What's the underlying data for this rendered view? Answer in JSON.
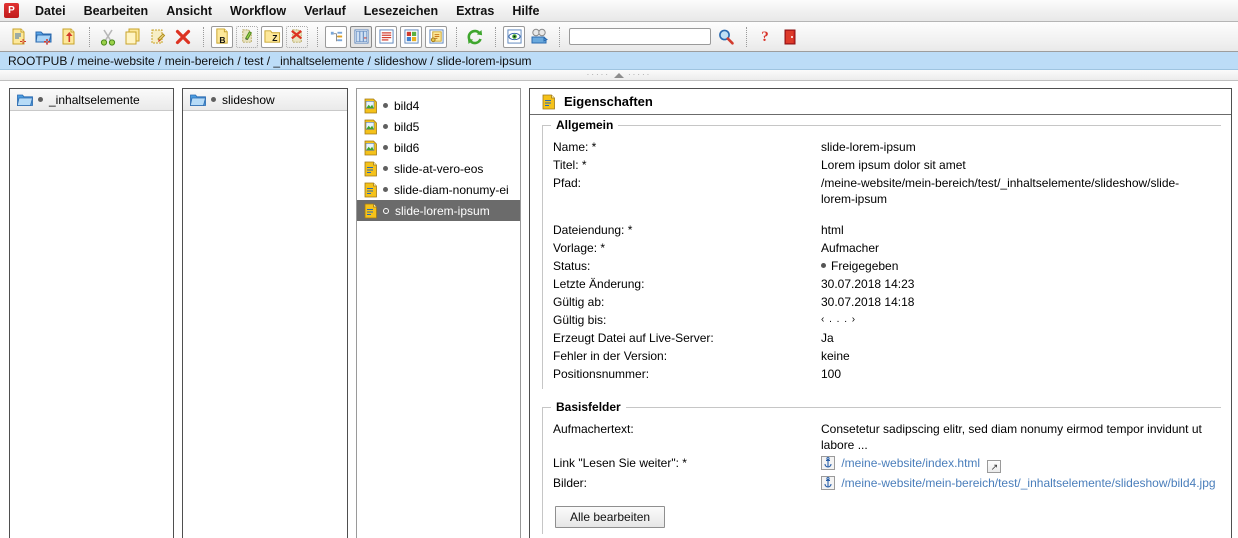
{
  "app": {
    "logo_text": "P",
    "menu": [
      "Datei",
      "Bearbeiten",
      "Ansicht",
      "Workflow",
      "Verlauf",
      "Lesezeichen",
      "Extras",
      "Hilfe"
    ]
  },
  "toolbar": {
    "search_value": "",
    "search_placeholder": "",
    "buttons": [
      {
        "name": "new-page-icon"
      },
      {
        "name": "new-folder-icon"
      },
      {
        "name": "upload-file-icon"
      },
      {
        "name": "cut-icon"
      },
      {
        "name": "copy-icon"
      },
      {
        "name": "paste-icon"
      },
      {
        "name": "delete-icon"
      },
      {
        "name": "edit-content-icon"
      },
      {
        "name": "edit-metadata-icon"
      },
      {
        "name": "edit-folder-icon"
      },
      {
        "name": "cancel-edit-icon"
      },
      {
        "name": "tree-view-icon"
      },
      {
        "name": "columns-view-icon"
      },
      {
        "name": "list-view-icon"
      },
      {
        "name": "thumbnail-view-icon"
      },
      {
        "name": "details-view-icon"
      },
      {
        "name": "refresh-icon"
      },
      {
        "name": "preview-icon"
      },
      {
        "name": "publish-icon"
      },
      {
        "name": "search-icon"
      },
      {
        "name": "help-icon"
      },
      {
        "name": "exit-icon"
      }
    ]
  },
  "breadcrumb": {
    "text": "ROOTPUB / meine-website / mein-bereich / test / _inhaltselemente / slideshow / slide-lorem-ipsum"
  },
  "columns": [
    {
      "header": {
        "label": "_inhaltselemente",
        "icon": "folder-icon"
      },
      "rows": []
    },
    {
      "header": {
        "label": "slideshow",
        "icon": "folder-icon"
      },
      "rows": []
    },
    {
      "header": null,
      "rows": [
        {
          "label": "bild4",
          "icon": "image-file-icon",
          "selected": false
        },
        {
          "label": "bild5",
          "icon": "image-file-icon",
          "selected": false
        },
        {
          "label": "bild6",
          "icon": "image-file-icon",
          "selected": false
        },
        {
          "label": "slide-at-vero-eos",
          "icon": "page-file-icon",
          "selected": false
        },
        {
          "label": "slide-diam-nonumy-ei",
          "icon": "page-file-icon",
          "selected": false
        },
        {
          "label": "slide-lorem-ipsum",
          "icon": "page-file-icon",
          "selected": true
        }
      ]
    }
  ],
  "panel": {
    "title": "Eigenschaften",
    "title_icon": "page-file-icon",
    "allgemein": {
      "legend": "Allgemein",
      "rows": [
        {
          "label": "Name: *",
          "value": "slide-lorem-ipsum",
          "style": "link"
        },
        {
          "label": "Titel: *",
          "value": "Lorem ipsum dolor sit amet",
          "style": "link"
        },
        {
          "label": "Pfad:",
          "value": "/meine-website/mein-bereich/test/_inhaltselemente/slideshow/slide-lorem-ipsum",
          "style": "plain"
        },
        {
          "label": "",
          "value": "",
          "style": "spacer"
        },
        {
          "label": "Dateiendung: *",
          "value": "html",
          "style": "link"
        },
        {
          "label": "Vorlage: *",
          "value": "Aufmacher",
          "style": "link"
        },
        {
          "label": "Status:",
          "value": "Freigegeben",
          "style": "status"
        },
        {
          "label": "Letzte Änderung:",
          "value": "30.07.2018 14:23",
          "style": "plain"
        },
        {
          "label": "Gültig ab:",
          "value": "30.07.2018 14:18",
          "style": "link"
        },
        {
          "label": "Gültig bis:",
          "value": "‹ . . . ›",
          "style": "empty"
        },
        {
          "label": "Erzeugt Datei auf Live-Server:",
          "value": "Ja",
          "style": "plain"
        },
        {
          "label": "Fehler in der Version:",
          "value": "keine",
          "style": "plain"
        },
        {
          "label": "Positionsnummer:",
          "value": "100",
          "style": "link"
        }
      ]
    },
    "basisfelder": {
      "legend": "Basisfelder",
      "rows": [
        {
          "label": "Aufmachertext:",
          "value": "Consetetur sadipscing elitr, sed diam nonumy eirmod tempor invidunt ut labore ...",
          "style": "link"
        },
        {
          "label": "Link \"Lesen Sie weiter\": *",
          "value": "/meine-website/index.html",
          "style": "anchorlink",
          "has_ext_button": true
        },
        {
          "label": "Bilder:",
          "value": "/meine-website/mein-bereich/test/_inhaltselemente/slideshow/bild4.jpg",
          "style": "anchorlink",
          "has_ext_button": false
        }
      ],
      "button_label": "Alle bearbeiten"
    }
  },
  "colors": {
    "breadcrumb_bg": "#bcdcf7",
    "selection_bg": "#6b6b6b",
    "link": "#4a7ebb",
    "accent_red": "#cc2222"
  }
}
